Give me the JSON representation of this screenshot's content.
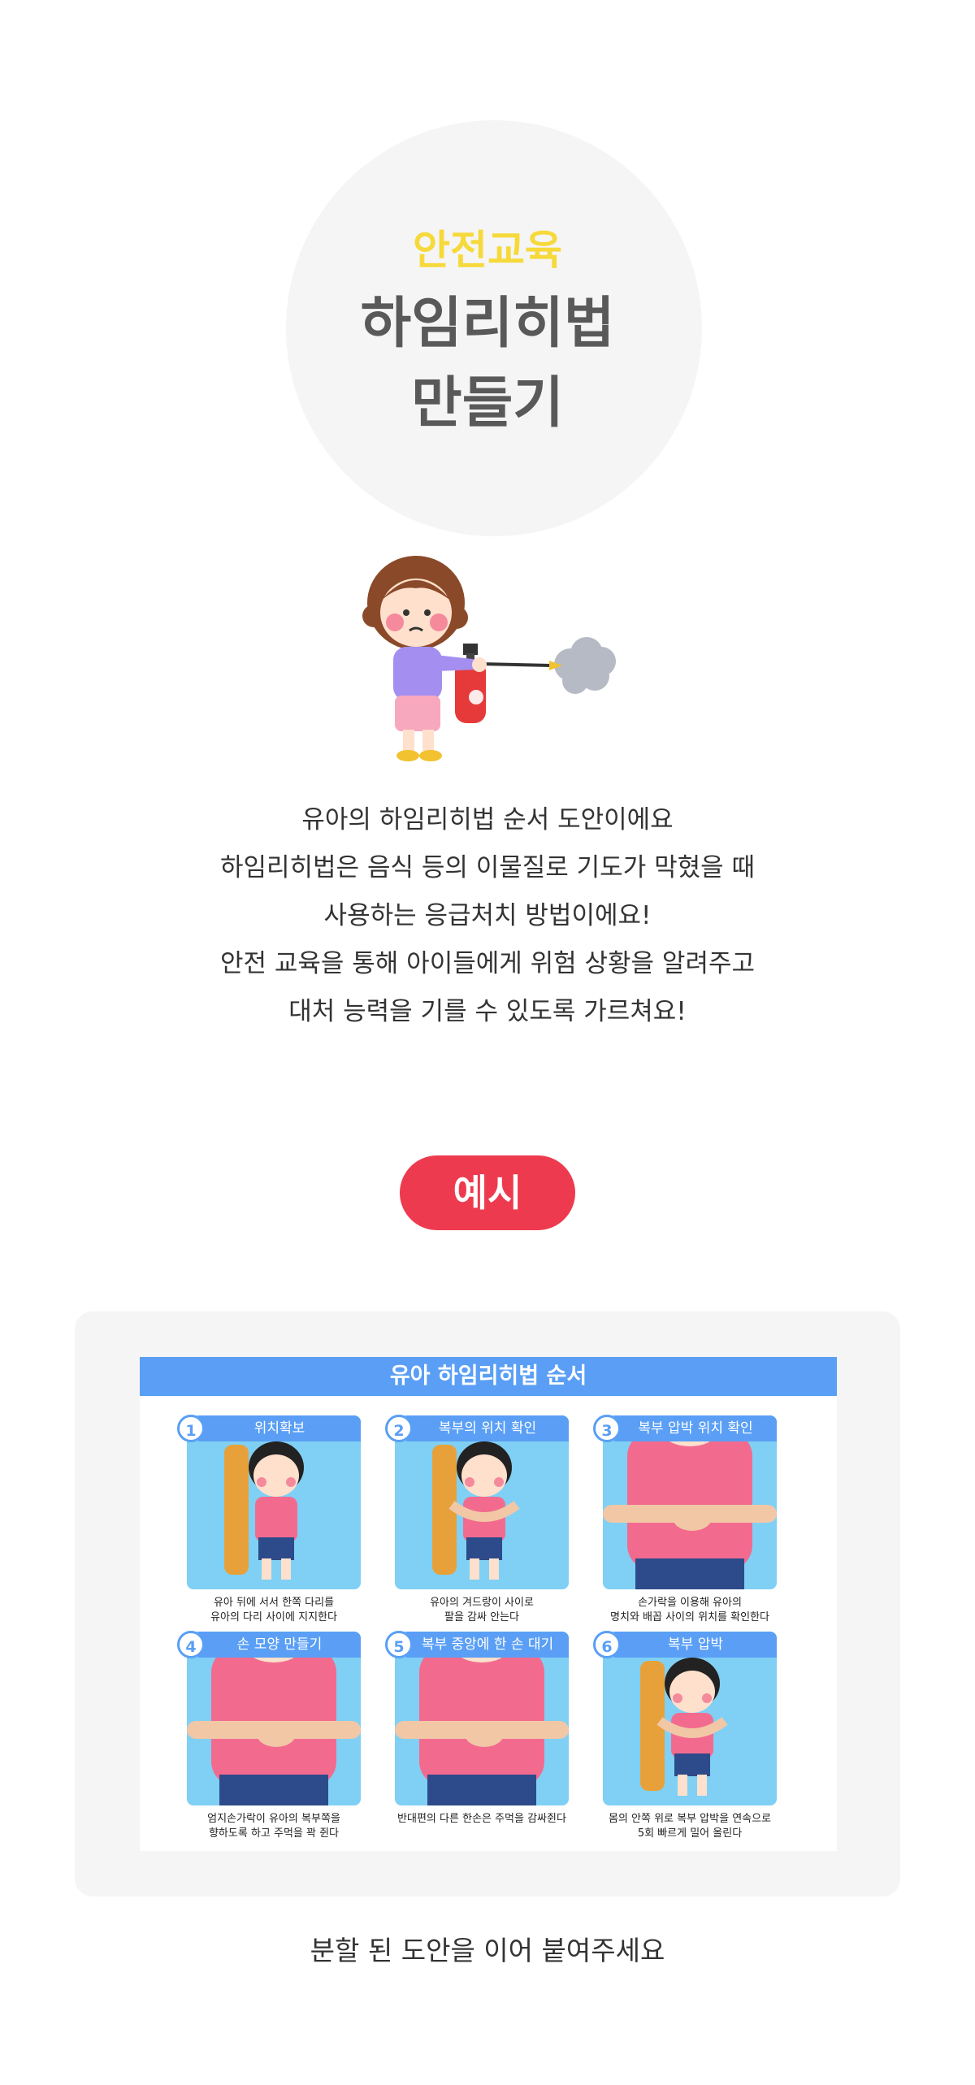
{
  "hero": {
    "subtitle": "안전교육",
    "title_line1": "하임리히법",
    "title_line2": "만들기"
  },
  "description": [
    "유아의 하임리히법 순서 도안이에요",
    "하임리히법은 음식 등의 이물질로 기도가 막혔을 때",
    "사용하는 응급처치 방법이에요!",
    "안전 교육을 통해 아이들에게 위험 상황을 알려주고",
    "대처 능력을 기를 수 있도록 가르쳐요!"
  ],
  "example_badge": "예시",
  "card": {
    "title": "유아 하임리히법 순서",
    "steps": [
      {
        "num": "1",
        "label": "위치확보",
        "caption1": "유아 뒤에 서서 한쪽 다리를",
        "caption2": "유아의 다리 사이에 지지한다"
      },
      {
        "num": "2",
        "label": "복부의 위치 확인",
        "caption1": "유아의 겨드랑이 사이로",
        "caption2": "팔을 감싸 안는다"
      },
      {
        "num": "3",
        "label": "복부 압박 위치 확인",
        "caption1": "손가락을 이용해 유아의",
        "caption2": "명치와 배꼽 사이의 위치를 확인한다"
      },
      {
        "num": "4",
        "label": "손 모양 만들기",
        "caption1": "엄지손가락이 유아의 복부쪽을",
        "caption2": "향하도록 하고 주먹을 꽉 쥔다"
      },
      {
        "num": "5",
        "label": "복부 중앙에 한 손 대기",
        "caption1": "반대편의 다른 한손은 주먹을 감싸쥔다",
        "caption2": ""
      },
      {
        "num": "6",
        "label": "복부 압박",
        "caption1": "몸의 안쪽 위로 복부 압박을 연속으로",
        "caption2": "5회 빠르게 밀어 올린다"
      }
    ]
  },
  "footer_note": "분할 된 도안을 이어 붙여주세요",
  "colors": {
    "subtitle": "#f6d93a",
    "title": "#595959",
    "badge": "#ee3a4f",
    "card_header": "#5a9ff5",
    "tile_bg": "#7fd0f4",
    "shirt": "#f26b8f",
    "circle_bg": "#f5f5f5"
  }
}
